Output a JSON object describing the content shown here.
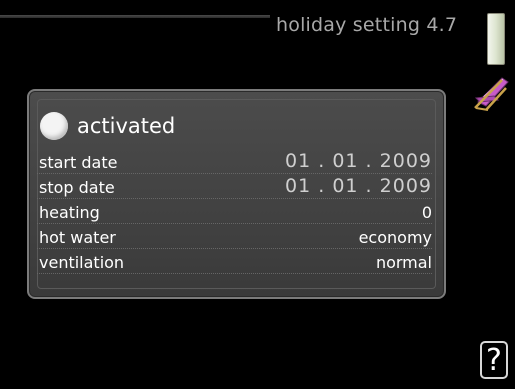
{
  "header": {
    "title": "holiday setting 4.7"
  },
  "panel": {
    "toggle_label": "activated",
    "rows": [
      {
        "label": "start date",
        "value": "01 . 01 . 2009"
      },
      {
        "label": "stop date",
        "value": "01 . 01 . 2009"
      },
      {
        "label": "heating",
        "value": "0"
      },
      {
        "label": "hot water",
        "value": "economy"
      },
      {
        "label": "ventilation",
        "value": "normal"
      }
    ]
  },
  "help": {
    "glyph": "?"
  },
  "icons": {
    "scrollbar": "scrollbar-thumb",
    "menu_icon": "deck-chair-icon",
    "help_icon": "help-icon"
  }
}
